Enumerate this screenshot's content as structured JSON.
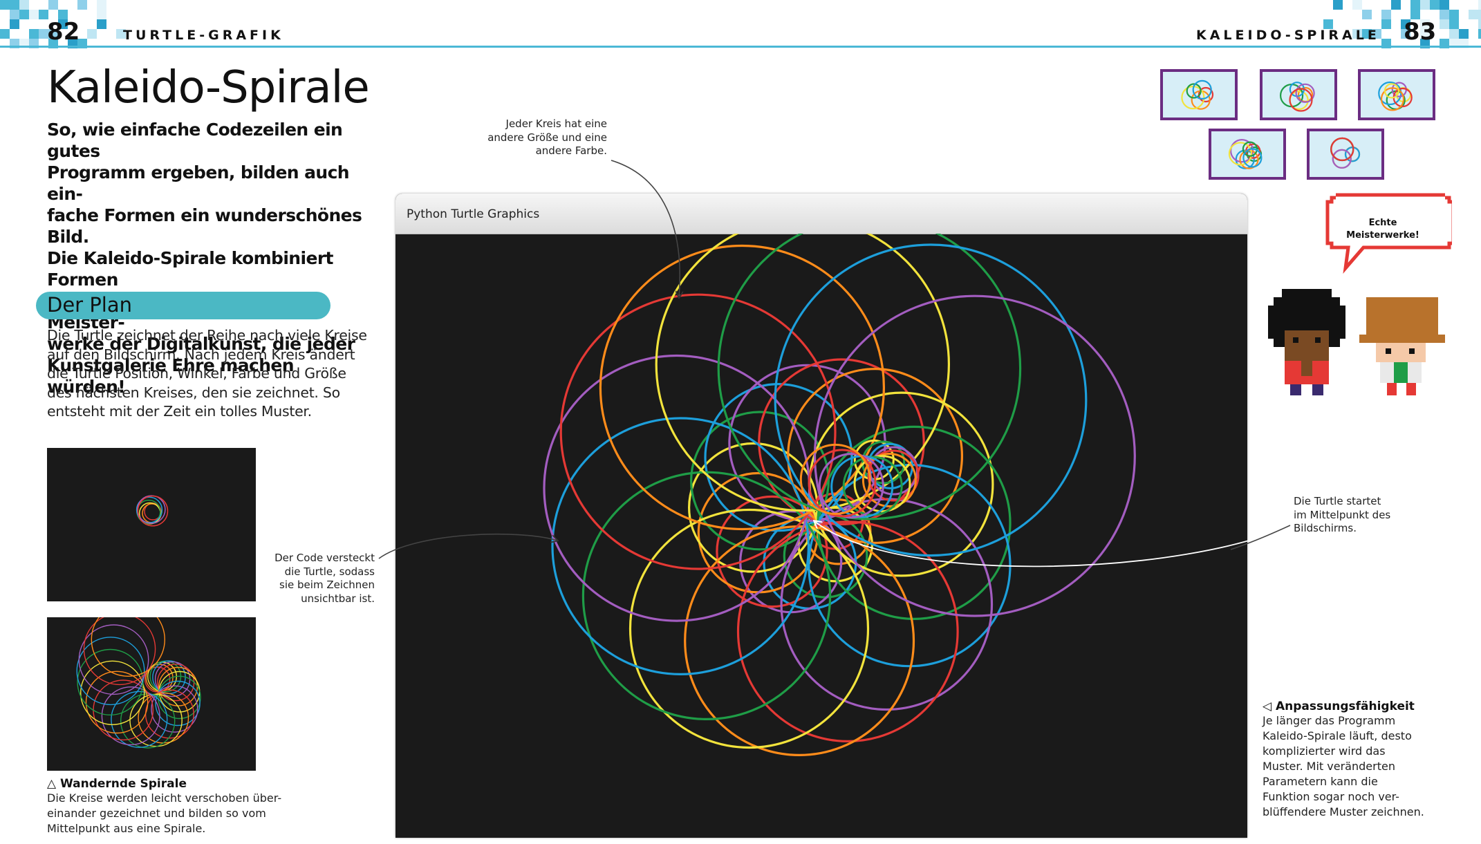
{
  "header": {
    "left_page_number": "82",
    "left_running_head": "TURTLE-GRAFIK",
    "right_running_head": "KALEIDO-SPIRALE",
    "right_page_number": "83"
  },
  "title": "Kaleido-Spirale",
  "intro": [
    "So, wie einfache Codezeilen ein gutes",
    "Programm ergeben, bilden auch ein-",
    "fache Formen ein wunderschönes Bild.",
    "Die Kaleido-Spirale kombiniert Formen",
    "und Farben und erschafft so Meister-",
    "werke der Digitalkunst, die jeder",
    "Kunstgalerie Ehre machen würden!"
  ],
  "plan": {
    "heading": "Der Plan",
    "body": [
      "Die Turtle zeichnet der Reihe nach viele Kreise",
      "auf den Bildschirm. Nach jedem Kreis ändert",
      "die Turtle Position, Winkel, Farbe und Größe",
      "des nächsten Kreises, den sie zeichnet. So",
      "entsteht mit der Zeit ein tolles Muster."
    ]
  },
  "caption_left": {
    "heading": "Wandernde Spirale",
    "body": [
      "Die Kreise werden leicht verschoben über-",
      "einander gezeichnet und bilden so vom",
      "Mittelpunkt aus eine Spirale."
    ]
  },
  "window": {
    "title": "Python Turtle Graphics"
  },
  "annotations": {
    "top": [
      "Jeder Kreis hat eine",
      "andere Größe und eine",
      "andere Farbe."
    ],
    "left": [
      "Der Code versteckt",
      "die Turtle, sodass",
      "sie beim Zeichnen",
      "unsichtbar ist."
    ],
    "right": [
      "Die Turtle startet",
      "im Mittelpunkt des",
      "Bildschirms."
    ]
  },
  "speech_bubble": [
    "Echte",
    "Meisterwerke!"
  ],
  "caption_right": {
    "heading": "Anpassungsfähigkeit",
    "body": [
      "Je länger das Programm",
      "Kaleido-Spirale läuft, desto",
      "komplizierter wird das",
      "Muster. Mit veränderten",
      "Parametern kann die",
      "Funktion sogar noch ver-",
      "blüffendere Muster zeichnen."
    ]
  },
  "colors": {
    "accent": "#4bb8c4",
    "header_rule": "#4bb8d6",
    "frame": "#6b2d82",
    "turtle_palette": [
      "#e53935",
      "#ff8c1a",
      "#f2e33c",
      "#1f9d47",
      "#1d9fdb",
      "#a35dc0"
    ]
  }
}
